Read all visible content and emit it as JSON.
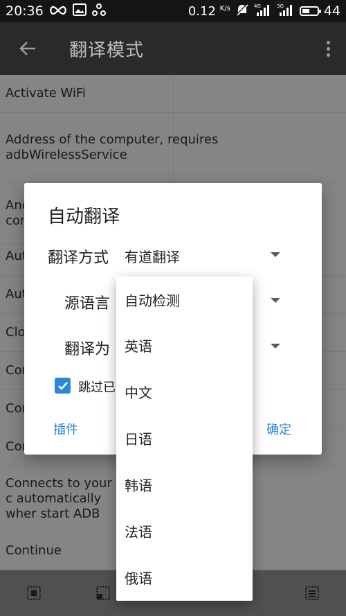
{
  "status_bar": {
    "time": "20:36",
    "speed_value": "0.12",
    "speed_unit": "K/s",
    "net_label_1": "4G",
    "net_label_2": "3G",
    "battery": "44",
    "icons": [
      "infinity-icon",
      "image-icon",
      "share-icon",
      "mute-icon",
      "signal-icon",
      "signal-icon",
      "battery-icon"
    ]
  },
  "app_bar": {
    "title": "翻译模式"
  },
  "list": {
    "items": [
      {
        "label": "Activate WiFi"
      },
      {
        "label": "Address of the computer, requires adbWirelessService"
      },
      {
        "label": "And con"
      },
      {
        "label": "Aut"
      },
      {
        "label": "Aut"
      },
      {
        "label": "Clo"
      },
      {
        "label": "Con"
      },
      {
        "label": "Con"
      },
      {
        "label": "Con"
      },
      {
        "label": "Connects to your c automatically wher start ADB"
      },
      {
        "label": "Continue"
      }
    ]
  },
  "dialog": {
    "title": "自动翻译",
    "method_label": "翻译方式",
    "method_value": "有道翻译",
    "source_label": "源语言",
    "target_label": "翻译为",
    "skip_label": "跳过已",
    "skip_checked": true,
    "plugins_button": "插件",
    "ok_button": "确定",
    "accent_color": "#2c86d9"
  },
  "dropdown": {
    "options": [
      "自动检测",
      "英语",
      "中文",
      "日语",
      "韩语",
      "法语",
      "俄语"
    ]
  }
}
